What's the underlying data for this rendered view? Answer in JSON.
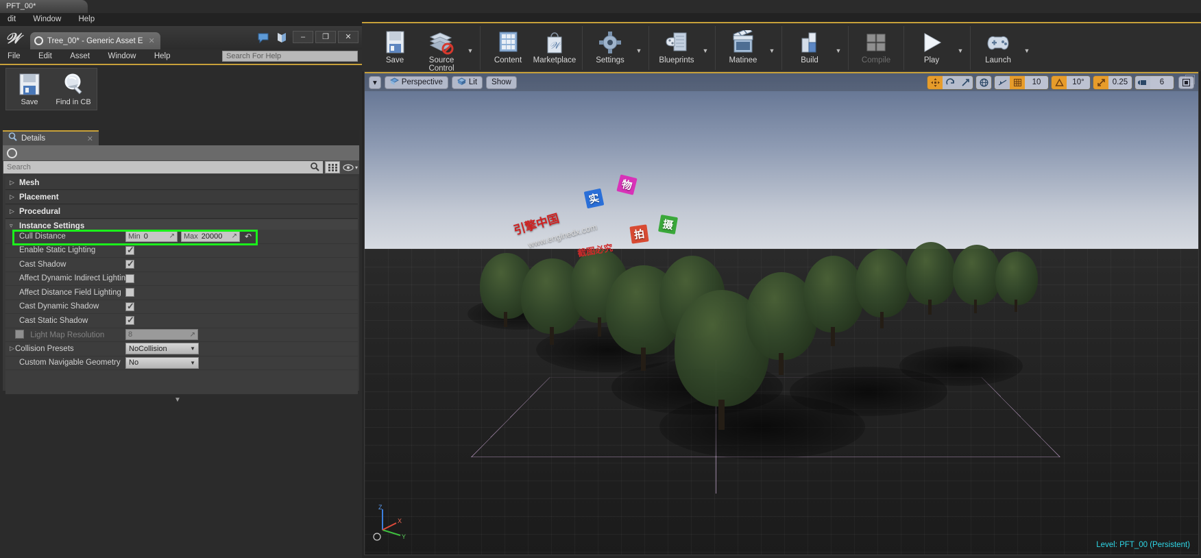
{
  "os": {
    "tab_title": "PFT_00*",
    "menus": [
      "dit",
      "Window",
      "Help"
    ]
  },
  "asset_editor": {
    "window_title": "Tree_00* - Generic Asset E",
    "menus": [
      "File",
      "Edit",
      "Asset",
      "Window",
      "Help"
    ],
    "help_search_placeholder": "Search For Help",
    "window_buttons": {
      "minimize": "–",
      "maximize": "❐",
      "close": "✕"
    },
    "toolbar": [
      {
        "label": "Save",
        "icon": "save-disk-icon"
      },
      {
        "label": "Find in CB",
        "icon": "magnifier-icon"
      }
    ]
  },
  "details": {
    "tab_label": "Details",
    "tab_icon": "details-magnifier-icon",
    "close_icon": "close-icon",
    "lock_icon": "lock-circle-icon",
    "search_placeholder": "Search",
    "search_icon": "search-icon",
    "grid_icon": "grid-view-icon",
    "eye_icon": "eye-icon",
    "categories": [
      {
        "label": "Mesh",
        "expanded": false
      },
      {
        "label": "Placement",
        "expanded": false
      },
      {
        "label": "Procedural",
        "expanded": false
      },
      {
        "label": "Instance Settings",
        "expanded": true
      }
    ],
    "properties": [
      {
        "name": "Cull Distance",
        "type": "minmax",
        "min_label": "Min",
        "min_value": "0",
        "max_label": "Max",
        "max_value": "20000",
        "highlighted": true,
        "has_revert": true
      },
      {
        "name": "Enable Static Lighting",
        "type": "checkbox",
        "checked": true
      },
      {
        "name": "Cast Shadow",
        "type": "checkbox",
        "checked": true
      },
      {
        "name": "Affect Dynamic Indirect Lighting",
        "type": "checkbox",
        "checked": false
      },
      {
        "name": "Affect Distance Field Lighting",
        "type": "checkbox",
        "checked": false
      },
      {
        "name": "Cast Dynamic Shadow",
        "type": "checkbox",
        "checked": true
      },
      {
        "name": "Cast Static Shadow",
        "type": "checkbox",
        "checked": true
      },
      {
        "name": "Light Map Resolution",
        "type": "number",
        "value": "8",
        "disabled": true,
        "has_checkbox": true
      },
      {
        "name": "Collision Presets",
        "type": "combo",
        "value": "NoCollision",
        "expandable": true
      },
      {
        "name": "Custom Navigable Geometry",
        "type": "combo",
        "value": "No"
      }
    ],
    "highlight_color": "#1bf01b"
  },
  "main_toolbar": {
    "groups": [
      {
        "items": [
          {
            "label": "Save",
            "icon": "save-disk-icon",
            "caret": false
          },
          {
            "label": "Source Control",
            "icon": "source-control-icon",
            "caret": true
          }
        ]
      },
      {
        "items": [
          {
            "label": "Content",
            "icon": "content-browser-icon",
            "caret": false
          },
          {
            "label": "Marketplace",
            "icon": "marketplace-bag-icon",
            "caret": false
          }
        ]
      },
      {
        "items": [
          {
            "label": "Settings",
            "icon": "settings-gear-icon",
            "caret": true
          }
        ]
      },
      {
        "items": [
          {
            "label": "Blueprints",
            "icon": "blueprints-icon",
            "caret": true
          }
        ]
      },
      {
        "items": [
          {
            "label": "Matinee",
            "icon": "matinee-clapboard-icon",
            "caret": true
          }
        ]
      },
      {
        "items": [
          {
            "label": "Build",
            "icon": "build-icon",
            "caret": true
          }
        ]
      },
      {
        "items": [
          {
            "label": "Compile",
            "icon": "compile-icon",
            "caret": false,
            "disabled": true
          }
        ]
      },
      {
        "items": [
          {
            "label": "Play",
            "icon": "play-triangle-icon",
            "caret": true
          }
        ]
      },
      {
        "items": [
          {
            "label": "Launch",
            "icon": "launch-gamepad-icon",
            "caret": true
          }
        ]
      }
    ]
  },
  "viewport": {
    "menu_caret": "▾",
    "camera_mode": "Perspective",
    "camera_icon": "camera-perspective-icon",
    "view_mode": "Lit",
    "view_mode_icon": "lit-cube-icon",
    "show_menu": "Show",
    "controls": {
      "transform_icons": [
        "select-move-icon",
        "rotate-icon",
        "scale-icon"
      ],
      "coordinate_icon": "world-coordinate-icon",
      "surface_snap_icon": "surface-snap-icon",
      "grid_snap_icon": "grid-snap-icon",
      "grid_snap_value": "10",
      "rotation_snap_icon": "rotation-snap-icon",
      "rotation_snap_value": "10°",
      "scale_snap_icon": "scale-snap-icon",
      "scale_snap_value": "0.25",
      "camera_speed_icon": "camera-speed-icon",
      "camera_speed_value": "6",
      "maximize_icon": "maximize-viewport-icon"
    },
    "gizmo_axes": [
      "Z",
      "Y",
      "X"
    ],
    "status": "Level:  PFT_00 (Persistent)",
    "status_color": "#2fd8e8"
  },
  "watermark": {
    "tags": [
      {
        "text": "实",
        "color": "#2a6fd8"
      },
      {
        "text": "物",
        "color": "#d832b8"
      },
      {
        "text": "拍",
        "color": "#d84a32"
      },
      {
        "text": "摄",
        "color": "#3aa83a"
      }
    ],
    "brand": "引擎中国",
    "url": "www.enginedx.com",
    "note": "截图必究"
  }
}
